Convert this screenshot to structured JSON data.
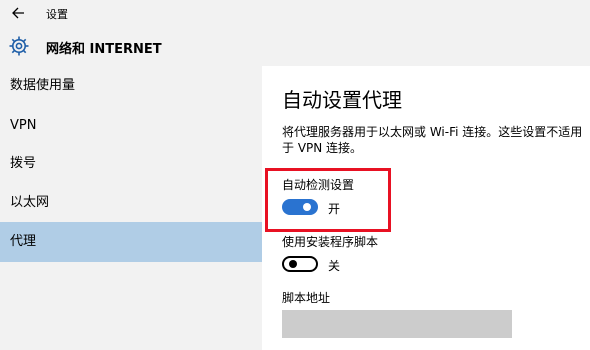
{
  "window": {
    "app_title": "设置"
  },
  "header": {
    "title": "网络和 INTERNET"
  },
  "sidebar": {
    "items": [
      {
        "label": "数据使用量"
      },
      {
        "label": "VPN"
      },
      {
        "label": "拨号"
      },
      {
        "label": "以太网"
      },
      {
        "label": "代理"
      }
    ],
    "selected": "代理"
  },
  "main": {
    "title": "自动设置代理",
    "description": "将代理服务器用于以太网或 Wi-Fi 连接。这些设置不适用于 VPN 连接。",
    "auto_detect": {
      "label": "自动检测设置",
      "state": "开",
      "enabled": true
    },
    "use_script": {
      "label": "使用安装程序脚本",
      "state": "关",
      "enabled": false
    },
    "script_address": {
      "label": "脚本地址",
      "value": ""
    }
  },
  "colors": {
    "accent": "#2a73d0",
    "selected_nav": "#b0cde6",
    "highlight_border": "#e81123",
    "chrome_bg": "#f2f2f2",
    "input_bg": "#cccccc"
  },
  "icons": {
    "back": "back-arrow-icon",
    "section": "gear-icon"
  }
}
